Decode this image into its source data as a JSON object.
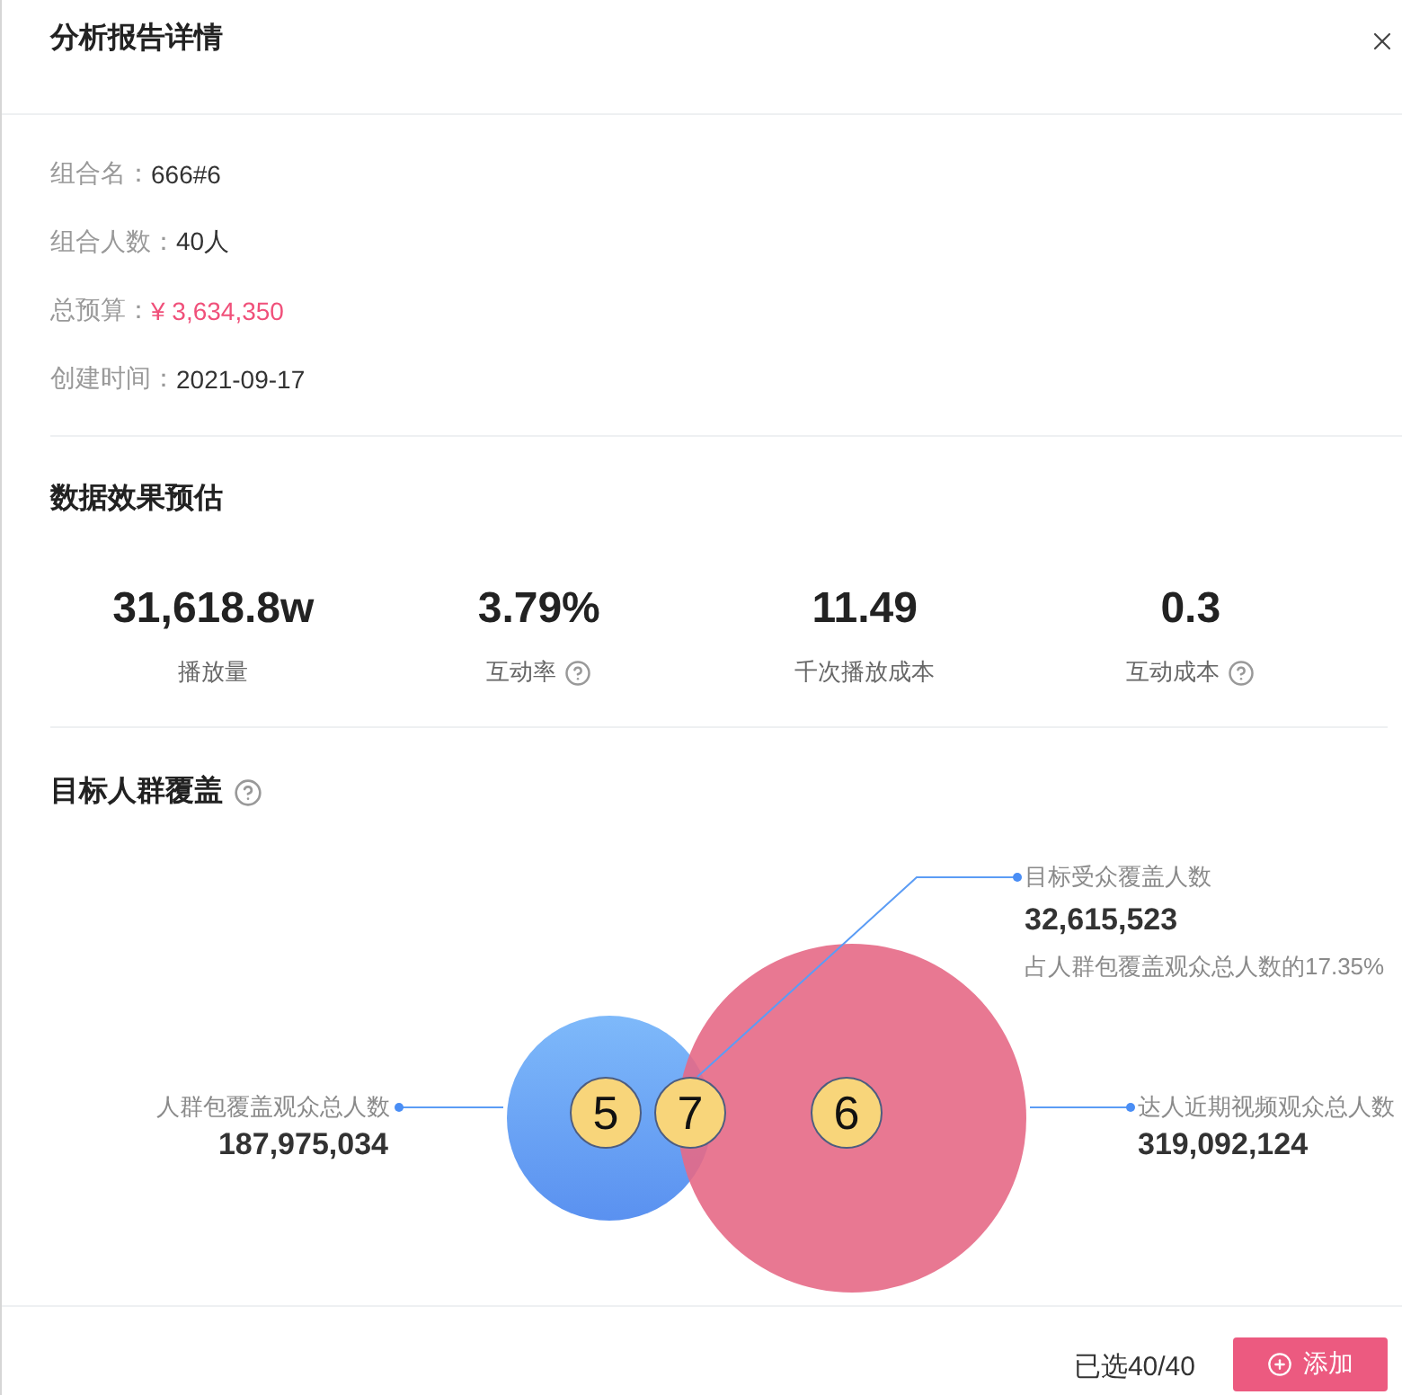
{
  "window": {
    "title": "分析报告详情"
  },
  "info": [
    {
      "label": "组合名：",
      "value": "666#6",
      "kind": "text"
    },
    {
      "label": "组合人数：",
      "value": "40人",
      "kind": "text"
    },
    {
      "label": "总预算：",
      "value": "¥ 3,634,350",
      "kind": "money"
    },
    {
      "label": "创建时间：",
      "value": "2021-09-17",
      "kind": "text"
    }
  ],
  "estimate": {
    "title": "数据效果预估",
    "metrics": [
      {
        "value": "31,618.8w",
        "label": "播放量",
        "help": false
      },
      {
        "value": "3.79%",
        "label": "互动率",
        "help": true
      },
      {
        "value": "11.49",
        "label": "千次播放成本",
        "help": false
      },
      {
        "value": "0.3",
        "label": "互动成本",
        "help": true
      }
    ]
  },
  "coverage": {
    "title": "目标人群覆盖",
    "help": true,
    "venn": {
      "left": {
        "label": "人群包覆盖观众总人数",
        "value": "187,975,034",
        "marker": "5"
      },
      "right": {
        "label": "达人近期视频观众总人数",
        "value": "319,092,124",
        "marker": "6"
      },
      "overlap": {
        "label": "目标受众覆盖人数",
        "value": "32,615,523",
        "note": "占人群包覆盖观众总人数的17.35%",
        "marker": "7"
      }
    }
  },
  "footer": {
    "selected": "已选40/40",
    "button": "添加"
  }
}
